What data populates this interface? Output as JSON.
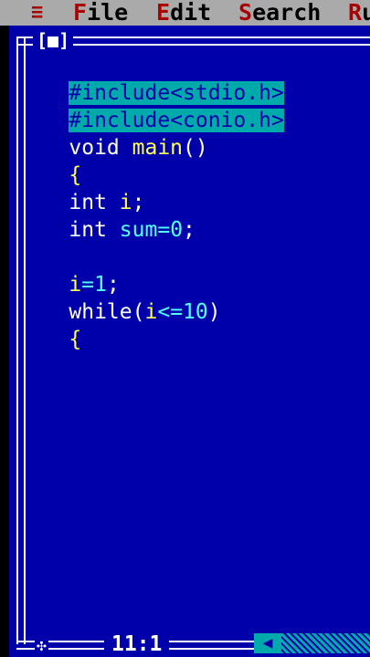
{
  "menu": {
    "system": "≡",
    "items": [
      {
        "hot": "F",
        "rest": "ile"
      },
      {
        "hot": "E",
        "rest": "dit"
      },
      {
        "hot": "S",
        "rest": "earch"
      },
      {
        "hot": "R",
        "rest": "u"
      }
    ]
  },
  "window": {
    "close_box": "[■]",
    "status": "11:1"
  },
  "code": [
    "#include<stdio.h>",
    "#include<conio.h>",
    "void main()",
    "{",
    "int i;",
    "int sum=0;",
    "",
    "i=1;",
    "while(i<=10)",
    "{"
  ],
  "colors": {
    "background": "#0000aa",
    "menubar": "#aaaaaa",
    "highlight": "#00aaaa",
    "keyword": "#ffffff",
    "identifier": "#ffff55",
    "number": "#55ffff"
  }
}
